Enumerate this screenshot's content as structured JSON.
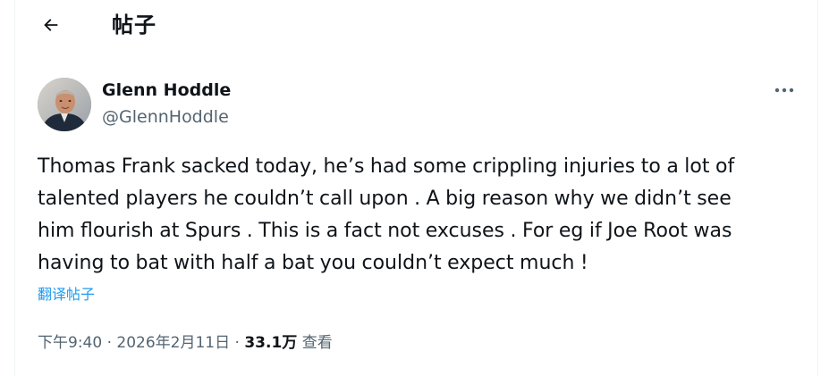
{
  "header": {
    "back_icon": "arrow-left-icon",
    "title": "帖子"
  },
  "post": {
    "author_name": "Glenn Hoddle",
    "author_handle": "@GlennHoddle",
    "more_icon": "more-horizontal-icon",
    "text": "Thomas Frank sacked today, he’s had some crippling injuries to a lot of\ntalented players he couldn’t call upon . A big reason why we didn’t see\nhim flourish at Spurs . This is a fact not excuses . For eg if Joe Root was\nhaving to bat with half a bat you couldn’t expect much !",
    "translate_label": "翻译帖子",
    "time": "下午9:40",
    "date": "2026年2月11日",
    "separator": "·",
    "views_count": "33.1万",
    "views_label": "查看"
  },
  "colors": {
    "text": "#0f1419",
    "secondary": "#536471",
    "link": "#1d9bf0",
    "border": "#eff3f4"
  }
}
